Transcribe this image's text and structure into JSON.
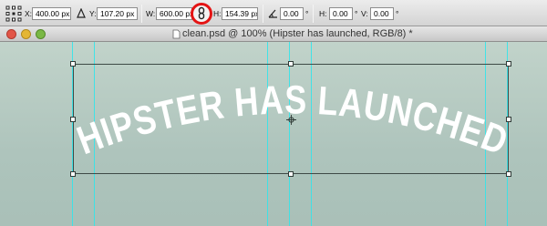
{
  "options_bar": {
    "x_label": "X:",
    "x_value": "400.00 px",
    "y_label": "Y:",
    "y_value": "107.20 px",
    "w_label": "W:",
    "w_value": "600.00 px",
    "h_label": "H:",
    "h_value": "154.39 px",
    "rotate_value": "0.00",
    "rotate_unit": "°",
    "hskew_label": "H:",
    "hskew_value": "0.00",
    "hskew_unit": "°",
    "vskew_label": "V:",
    "vskew_value": "0.00",
    "vskew_unit": "°",
    "icons": {
      "reference_point": "reference-point-icon",
      "relative": "delta-icon",
      "link": "link-icon",
      "rotate": "angle-icon"
    },
    "highlight_color": "#e41414"
  },
  "window": {
    "title": "clean.psd @ 100% (Hipster has launched, RGB/8) *",
    "traffic_lights": {
      "close": "#e25548",
      "minimize": "#e4b634",
      "zoom": "#7ab845"
    }
  },
  "canvas": {
    "artwork_text": "HIPSTER HAS LAUNCHED",
    "artwork_color": "#ffffff",
    "guide_color": "#33e4ea",
    "background_color": "#b0c5bd"
  }
}
